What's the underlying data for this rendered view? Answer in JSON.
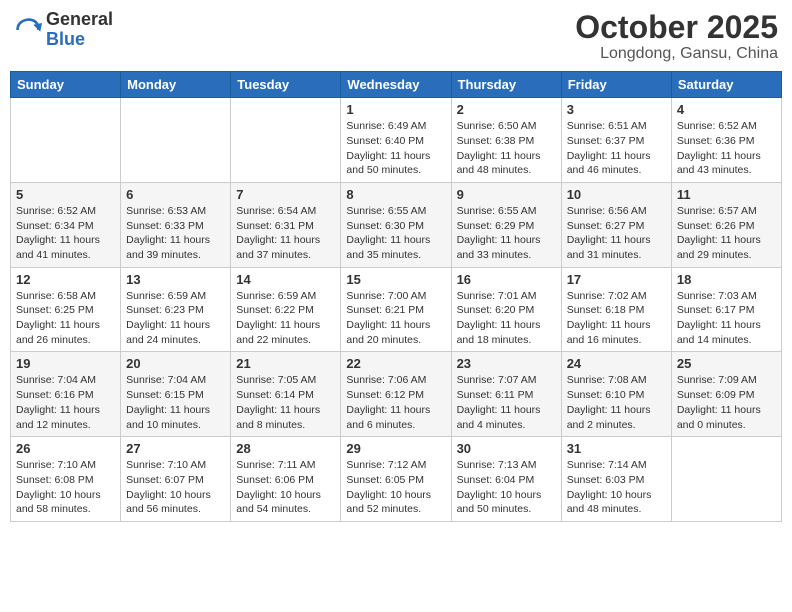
{
  "header": {
    "logo_general": "General",
    "logo_blue": "Blue",
    "month_title": "October 2025",
    "location": "Longdong, Gansu, China"
  },
  "days_of_week": [
    "Sunday",
    "Monday",
    "Tuesday",
    "Wednesday",
    "Thursday",
    "Friday",
    "Saturday"
  ],
  "weeks": [
    [
      {
        "day": "",
        "info": ""
      },
      {
        "day": "",
        "info": ""
      },
      {
        "day": "",
        "info": ""
      },
      {
        "day": "1",
        "info": "Sunrise: 6:49 AM\nSunset: 6:40 PM\nDaylight: 11 hours\nand 50 minutes."
      },
      {
        "day": "2",
        "info": "Sunrise: 6:50 AM\nSunset: 6:38 PM\nDaylight: 11 hours\nand 48 minutes."
      },
      {
        "day": "3",
        "info": "Sunrise: 6:51 AM\nSunset: 6:37 PM\nDaylight: 11 hours\nand 46 minutes."
      },
      {
        "day": "4",
        "info": "Sunrise: 6:52 AM\nSunset: 6:36 PM\nDaylight: 11 hours\nand 43 minutes."
      }
    ],
    [
      {
        "day": "5",
        "info": "Sunrise: 6:52 AM\nSunset: 6:34 PM\nDaylight: 11 hours\nand 41 minutes."
      },
      {
        "day": "6",
        "info": "Sunrise: 6:53 AM\nSunset: 6:33 PM\nDaylight: 11 hours\nand 39 minutes."
      },
      {
        "day": "7",
        "info": "Sunrise: 6:54 AM\nSunset: 6:31 PM\nDaylight: 11 hours\nand 37 minutes."
      },
      {
        "day": "8",
        "info": "Sunrise: 6:55 AM\nSunset: 6:30 PM\nDaylight: 11 hours\nand 35 minutes."
      },
      {
        "day": "9",
        "info": "Sunrise: 6:55 AM\nSunset: 6:29 PM\nDaylight: 11 hours\nand 33 minutes."
      },
      {
        "day": "10",
        "info": "Sunrise: 6:56 AM\nSunset: 6:27 PM\nDaylight: 11 hours\nand 31 minutes."
      },
      {
        "day": "11",
        "info": "Sunrise: 6:57 AM\nSunset: 6:26 PM\nDaylight: 11 hours\nand 29 minutes."
      }
    ],
    [
      {
        "day": "12",
        "info": "Sunrise: 6:58 AM\nSunset: 6:25 PM\nDaylight: 11 hours\nand 26 minutes."
      },
      {
        "day": "13",
        "info": "Sunrise: 6:59 AM\nSunset: 6:23 PM\nDaylight: 11 hours\nand 24 minutes."
      },
      {
        "day": "14",
        "info": "Sunrise: 6:59 AM\nSunset: 6:22 PM\nDaylight: 11 hours\nand 22 minutes."
      },
      {
        "day": "15",
        "info": "Sunrise: 7:00 AM\nSunset: 6:21 PM\nDaylight: 11 hours\nand 20 minutes."
      },
      {
        "day": "16",
        "info": "Sunrise: 7:01 AM\nSunset: 6:20 PM\nDaylight: 11 hours\nand 18 minutes."
      },
      {
        "day": "17",
        "info": "Sunrise: 7:02 AM\nSunset: 6:18 PM\nDaylight: 11 hours\nand 16 minutes."
      },
      {
        "day": "18",
        "info": "Sunrise: 7:03 AM\nSunset: 6:17 PM\nDaylight: 11 hours\nand 14 minutes."
      }
    ],
    [
      {
        "day": "19",
        "info": "Sunrise: 7:04 AM\nSunset: 6:16 PM\nDaylight: 11 hours\nand 12 minutes."
      },
      {
        "day": "20",
        "info": "Sunrise: 7:04 AM\nSunset: 6:15 PM\nDaylight: 11 hours\nand 10 minutes."
      },
      {
        "day": "21",
        "info": "Sunrise: 7:05 AM\nSunset: 6:14 PM\nDaylight: 11 hours\nand 8 minutes."
      },
      {
        "day": "22",
        "info": "Sunrise: 7:06 AM\nSunset: 6:12 PM\nDaylight: 11 hours\nand 6 minutes."
      },
      {
        "day": "23",
        "info": "Sunrise: 7:07 AM\nSunset: 6:11 PM\nDaylight: 11 hours\nand 4 minutes."
      },
      {
        "day": "24",
        "info": "Sunrise: 7:08 AM\nSunset: 6:10 PM\nDaylight: 11 hours\nand 2 minutes."
      },
      {
        "day": "25",
        "info": "Sunrise: 7:09 AM\nSunset: 6:09 PM\nDaylight: 11 hours\nand 0 minutes."
      }
    ],
    [
      {
        "day": "26",
        "info": "Sunrise: 7:10 AM\nSunset: 6:08 PM\nDaylight: 10 hours\nand 58 minutes."
      },
      {
        "day": "27",
        "info": "Sunrise: 7:10 AM\nSunset: 6:07 PM\nDaylight: 10 hours\nand 56 minutes."
      },
      {
        "day": "28",
        "info": "Sunrise: 7:11 AM\nSunset: 6:06 PM\nDaylight: 10 hours\nand 54 minutes."
      },
      {
        "day": "29",
        "info": "Sunrise: 7:12 AM\nSunset: 6:05 PM\nDaylight: 10 hours\nand 52 minutes."
      },
      {
        "day": "30",
        "info": "Sunrise: 7:13 AM\nSunset: 6:04 PM\nDaylight: 10 hours\nand 50 minutes."
      },
      {
        "day": "31",
        "info": "Sunrise: 7:14 AM\nSunset: 6:03 PM\nDaylight: 10 hours\nand 48 minutes."
      },
      {
        "day": "",
        "info": ""
      }
    ]
  ]
}
